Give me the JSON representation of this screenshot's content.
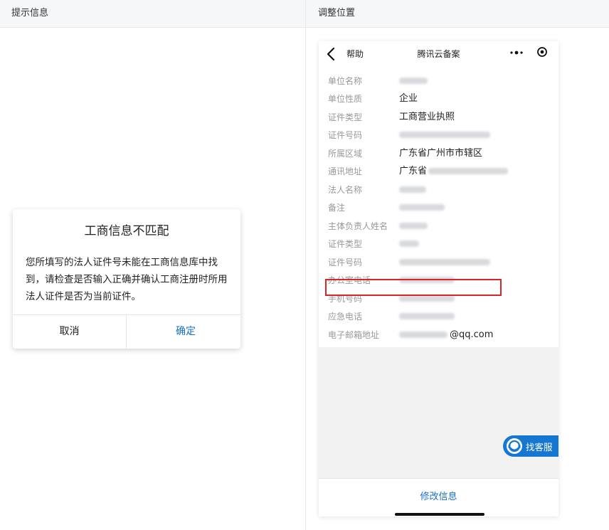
{
  "headers": {
    "left": "提示信息",
    "right": "调整位置"
  },
  "dialog": {
    "title": "工商信息不匹配",
    "message": "您所填写的法人证件号未能在工商信息库中找到，请检查是否输入正确并确认工商注册时所用法人证件是否为当前证件。",
    "cancel": "取消",
    "confirm": "确定"
  },
  "phone": {
    "nav": {
      "back_label": "帮助",
      "title": "腾讯云备案"
    },
    "rows": [
      {
        "label": "单位名称",
        "value": ""
      },
      {
        "label": "单位性质",
        "value": "企业"
      },
      {
        "label": "证件类型",
        "value": "工商营业执照"
      },
      {
        "label": "证件号码",
        "value": ""
      },
      {
        "label": "所属区域",
        "value": "广东省广州市市辖区"
      },
      {
        "label": "通讯地址",
        "value": "广东省"
      },
      {
        "label": "法人名称",
        "value": ""
      },
      {
        "label": "备注",
        "value": ""
      },
      {
        "label": "主体负责人姓名",
        "value": ""
      },
      {
        "label": "证件类型",
        "value": ""
      },
      {
        "label": "证件号码",
        "value": ""
      },
      {
        "label": "办公室电话",
        "value": ""
      },
      {
        "label": "手机号码",
        "value": ""
      },
      {
        "label": "应急电话",
        "value": ""
      },
      {
        "label": "电子邮箱地址",
        "value": "@qq.com"
      }
    ],
    "support_label": "找客服",
    "modify_label": "修改信息"
  },
  "colors": {
    "accent": "#1a6fc4",
    "highlight": "#d9242a",
    "support_bg": "#1677d2"
  }
}
